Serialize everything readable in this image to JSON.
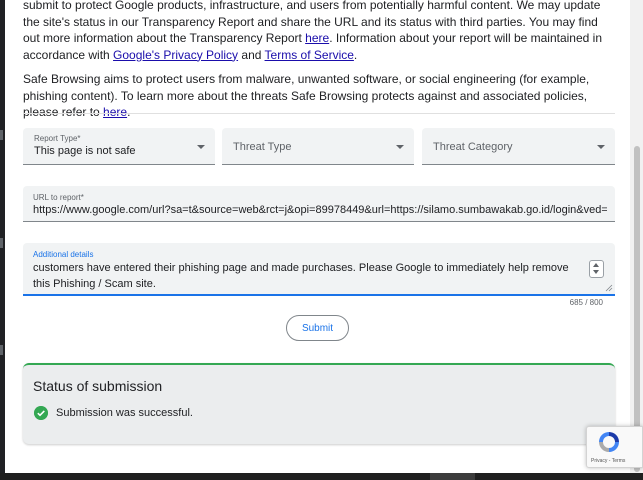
{
  "intro": {
    "p1_parts": [
      {
        "text": "submit to protect Google products, infrastructure, and users from potentially harmful content. We may update the site's status in our Transparency Report and share the URL and its status with third parties. You may find out more information about the Transparency Report "
      },
      {
        "text": "here",
        "link": true
      },
      {
        "text": ". Information about your report will be maintained in accordance with "
      },
      {
        "text": "Google's Privacy Policy",
        "link": true
      },
      {
        "text": " and "
      },
      {
        "text": "Terms of Service",
        "link": true
      },
      {
        "text": "."
      }
    ],
    "p2_parts": [
      {
        "text": "Safe Browsing aims to protect users from malware, unwanted software, or social engineering (for example, phishing content). To learn more about the threats Safe Browsing protects against and associated policies, please refer to "
      },
      {
        "text": "here",
        "link": true
      },
      {
        "text": "."
      }
    ]
  },
  "form": {
    "report_type": {
      "label": "Report Type*",
      "value": "This page is not safe"
    },
    "threat_type": {
      "placeholder": "Threat Type"
    },
    "threat_category": {
      "placeholder": "Threat Category"
    },
    "url": {
      "label": "URL to report*",
      "value": "https://www.google.com/url?sa=t&source=web&rct=j&opi=89978449&url=https://silamo.sumbawakab.go.id/login&ved="
    },
    "details": {
      "label": "Additional details",
      "value": "customers have entered their phishing page and made purchases. Please Google to immediately help remove this Phishing / Scam site."
    },
    "counter": "685 / 800",
    "submit_label": "Submit"
  },
  "status": {
    "title": "Status of submission",
    "message": "Submission was successful."
  },
  "recaptcha": {
    "links": "Privacy - Terms"
  },
  "colors": {
    "link": "#1a0dab",
    "accent": "#1a73e8",
    "success": "#34a853"
  },
  "icons": [
    "check-circle-icon",
    "caret-down-icon",
    "recaptcha-logo-icon",
    "spinner-icon",
    "resize-grip-icon"
  ]
}
